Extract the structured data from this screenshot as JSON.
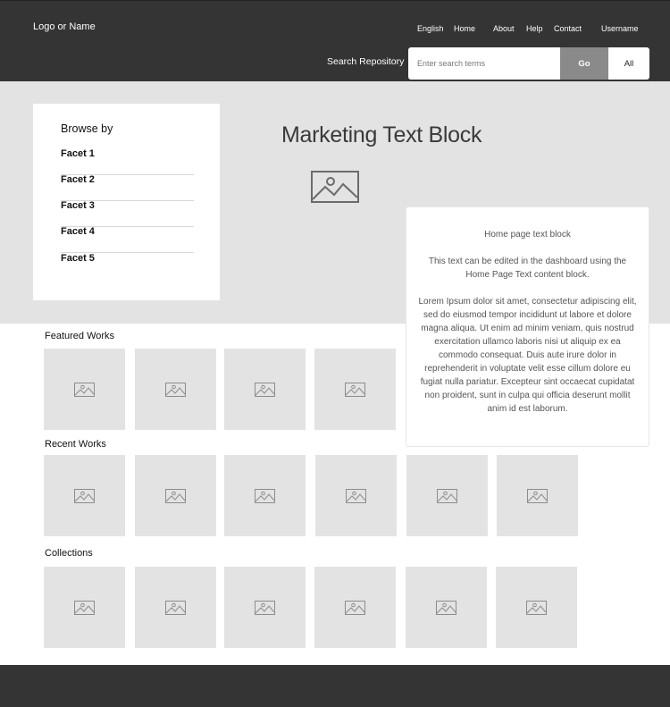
{
  "header": {
    "logo": "Logo or Name",
    "nav": [
      "English",
      "Home",
      "About",
      "Help",
      "Contact",
      "Username"
    ],
    "search_label": "Search Repository",
    "search_placeholder": "Enter search terms",
    "go_label": "Go",
    "all_label": "All"
  },
  "browse": {
    "title": "Browse by",
    "facets": [
      "Facet 1",
      "Facet 2",
      "Facet 3",
      "Facet 4",
      "Facet 5"
    ]
  },
  "hero": {
    "marketing_title": "Marketing Text Block",
    "image_icon": "image-icon"
  },
  "text_block": {
    "title": "Home page text block",
    "para1": "This text can be edited in the dashboard using the Home Page Text content block.",
    "para2": "Lorem Ipsum dolor sit amet, consectetur adipiscing elit, sed do eiusmod tempor incididunt ut labore et dolore magna aliqua. Ut enim ad minim veniam, quis nostrud exercitation ullamco laboris nisi ut aliquip ex ea commodo consequat. Duis aute irure dolor in reprehenderit in voluptate velit esse cillum dolore eu fugiat nulla pariatur. Excepteur sint occaecat cupidatat non proident, sunt in culpa qui officia deserunt mollit anim id est laborum."
  },
  "sections": {
    "featured": {
      "title": "Featured Works",
      "count": 4
    },
    "recent": {
      "title": "Recent Works",
      "count": 6
    },
    "collections": {
      "title": "Collections",
      "count": 6
    }
  },
  "colors": {
    "header_bg": "#343434",
    "hero_bg": "#e3e3e3",
    "go_button": "#8a8a8a",
    "placeholder_bg": "#e3e3e3"
  }
}
